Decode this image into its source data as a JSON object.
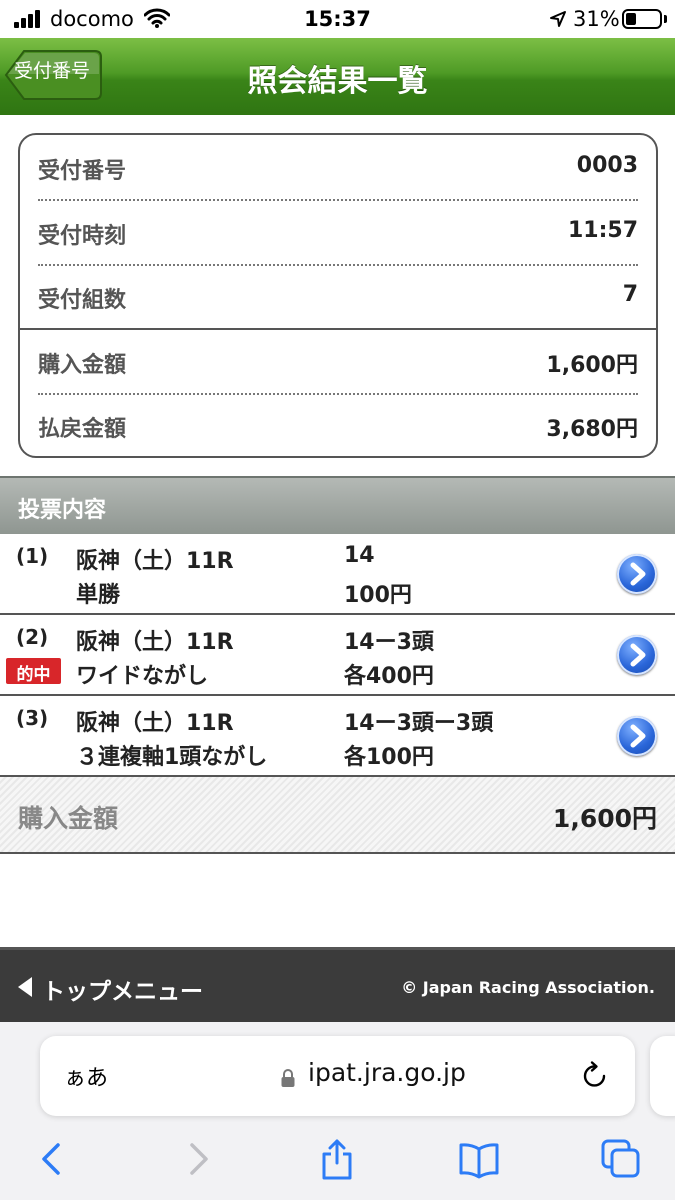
{
  "status_bar": {
    "carrier": "docomo",
    "time": "15:37",
    "battery_percent": "31%",
    "battery_level": 0.31
  },
  "header": {
    "back_label": "受付番号",
    "title": "照会結果一覧"
  },
  "receipt": {
    "rows": [
      {
        "label": "受付番号",
        "value": "0003"
      },
      {
        "label": "受付時刻",
        "value": "11:57"
      },
      {
        "label": "受付組数",
        "value": "7"
      },
      {
        "label": "購入金額",
        "value": "1,600円"
      },
      {
        "label": "払戻金額",
        "value": "3,680円"
      }
    ]
  },
  "section": {
    "title": "投票内容"
  },
  "tickets": [
    {
      "num": "(1)",
      "race": "阪神（土）11R",
      "type": "単勝",
      "combo": "14",
      "amount": "100円",
      "hit": false,
      "hit_label": ""
    },
    {
      "num": "(2)",
      "race": "阪神（土）11R",
      "type": "ワイドながし",
      "combo": "14ー3頭",
      "amount": "各400円",
      "hit": true,
      "hit_label": "的中"
    },
    {
      "num": "(3)",
      "race": "阪神（土）11R",
      "type": "３連複軸1頭ながし",
      "combo": "14ー3頭ー3頭",
      "amount": "各100円",
      "hit": false,
      "hit_label": ""
    }
  ],
  "total": {
    "label": "購入金額",
    "value": "1,600円"
  },
  "footer": {
    "back_label": "トップメニュー",
    "copyright": "© Japan Racing Association."
  },
  "browser": {
    "text_size_label": "ぁあ",
    "url": "ipat.jra.go.jp"
  },
  "colors": {
    "header_green": "#3a8418",
    "hit_red": "#d8262a",
    "arrow_blue": "#2a66d9",
    "safari_blue": "#2d7cf6"
  }
}
